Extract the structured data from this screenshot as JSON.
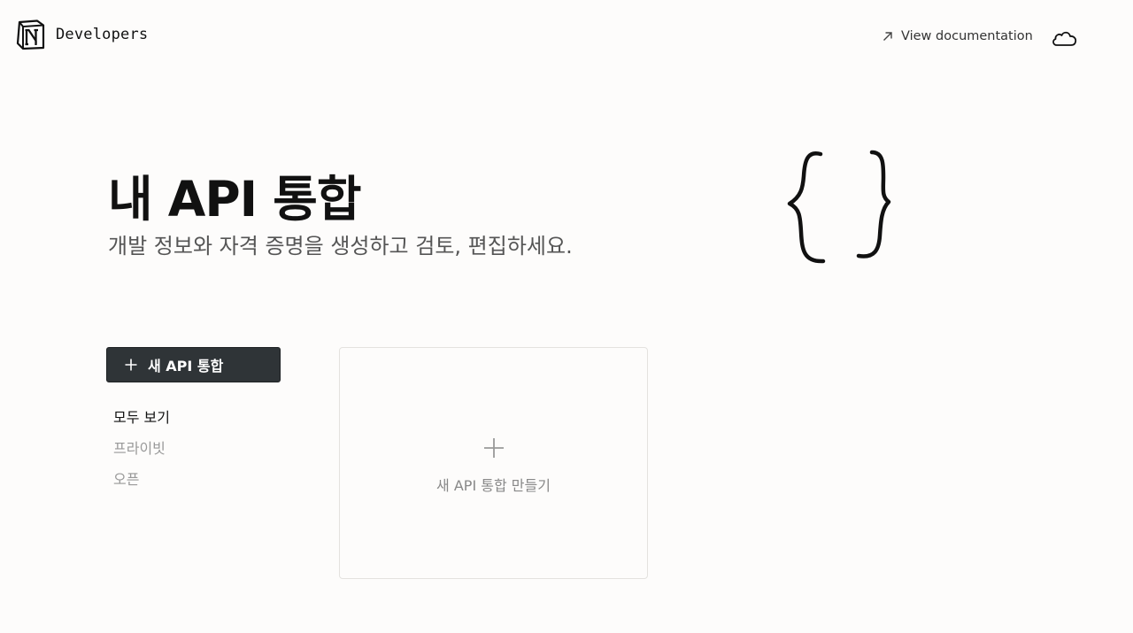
{
  "header": {
    "brand": "Developers",
    "doc_link": "View documentation",
    "logo_icon": "notion-logo-icon",
    "cloud_icon": "cloud-icon",
    "arrow_icon": "arrow-up-right-icon"
  },
  "hero": {
    "title": "내 API 통합",
    "subtitle": "개발 정보와 자격 증명을 생성하고 검토, 편집하세요.",
    "illustration_icon": "curly-braces-icon"
  },
  "sidebar": {
    "new_button": "새 API 통합",
    "filters": [
      {
        "label": "모두 보기",
        "active": true
      },
      {
        "label": "프라이빗",
        "active": false
      },
      {
        "label": "오픈",
        "active": false
      }
    ]
  },
  "create_card": {
    "label": "새 API 통합 만들기",
    "icon": "plus-icon"
  },
  "colors": {
    "background": "#fdfcfb",
    "button_bg": "#2f3437",
    "text_primary": "#111111",
    "text_muted": "#999999"
  }
}
